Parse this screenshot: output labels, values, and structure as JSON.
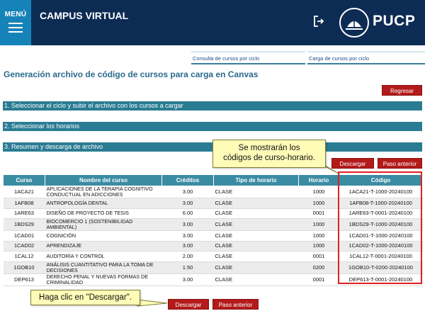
{
  "header": {
    "menu_label": "MENÚ",
    "app_title": "CAMPUS VIRTUAL",
    "logo_text": "PUCP"
  },
  "top_links": [
    {
      "label": "Consulta de cursos por ciclo"
    },
    {
      "label": "Carga de cursos por ciclo"
    }
  ],
  "page_title": "Generación archivo de código de cursos para carga en Canvas",
  "buttons": {
    "regresar": "Regresar",
    "descargar": "Descargar",
    "paso_anterior": "Paso anterior"
  },
  "sections": [
    {
      "label": "1. Seleccionar el ciclo y subir el archivo con los cursos a cargar"
    },
    {
      "label": "2. Seleccionar los horarios"
    },
    {
      "label": "3. Resumen y descarga de archivo"
    }
  ],
  "table": {
    "headers": [
      "Curso",
      "Nombre del curso",
      "Créditos",
      "Tipo de horario",
      "Horario",
      "Código"
    ],
    "rows": [
      [
        "1ACA21",
        "APLICACIONES DE LA TERAPIA COGNITIVO CONDUCTUAL EN ADICCIONES",
        "3.00",
        "CLASE",
        "1000",
        "1ACA21-T-1000-20240100"
      ],
      [
        "1AFB08",
        "ANTROPOLOGÍA DENTAL",
        "3.00",
        "CLASE",
        "1000",
        "1AFB08-T-1000-20240100"
      ],
      [
        "1ARE63",
        "DISEÑO DE PROYECTO DE TESIS",
        "6.00",
        "CLASE",
        "0001",
        "1ARE63-T-0001-20240100"
      ],
      [
        "1BDS29",
        "BIOCOMERCIO 1 (SOSTENIBILIDAD AMBIENTAL)",
        "3.00",
        "CLASE",
        "1000",
        "1BDS29-T-1000-20240100"
      ],
      [
        "1CAD01",
        "COGNICIÓN",
        "3.00",
        "CLASE",
        "1000",
        "1CAD01-T-1000-20240100"
      ],
      [
        "1CAD02",
        "APRENDIZAJE",
        "3.00",
        "CLASE",
        "1000",
        "1CAD02-T-1000-20240100"
      ],
      [
        "1CAL12",
        "AUDITORÍA Y CONTROL",
        "2.00",
        "CLASE",
        "0001",
        "1CAL12-T-0001-20240100"
      ],
      [
        "1GOB10",
        "ANÁLISIS CUANTITATIVO PARA LA TOMA DE DECISIONES",
        "1.50",
        "CLASE",
        "0200",
        "1GOB10-T-0200-20240100"
      ],
      [
        "DEP613",
        "DERECHO PENAL Y NUEVAS FORMAS DE CRIMINALIDAD",
        "3.00",
        "CLASE",
        "0001",
        "DEP613-T-0001-20240100"
      ]
    ]
  },
  "callouts": {
    "codes_line1": "Se mostrarán los",
    "codes_line2": "códigos de curso-horario.",
    "download": "Haga clic en \"Descargar\"."
  },
  "colors": {
    "header_bg": "#0d2c54",
    "menu_bg": "#1683b8",
    "section_bar": "#2a7c93",
    "table_header": "#3a8ca3",
    "button_red": "#b31b1b",
    "callout_bg": "#fffcb8",
    "highlight_border": "#e02020"
  },
  "icons": {
    "menu": "hamburger-icon",
    "logout": "logout-icon",
    "logo": "pucp-logo"
  }
}
